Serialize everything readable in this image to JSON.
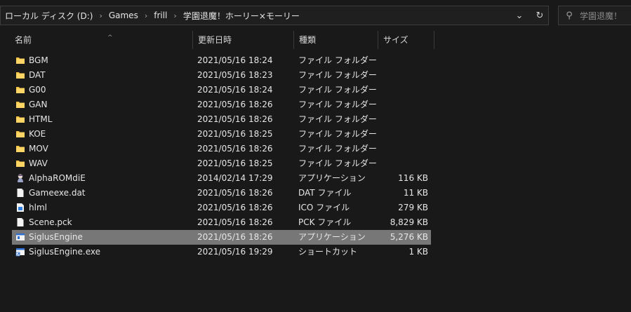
{
  "breadcrumb": {
    "items": [
      "ローカル ディスク (D:)",
      "Games",
      "frill",
      "学園退魔！ホーリー×モーリー"
    ]
  },
  "search": {
    "placeholder": "学園退魔！"
  },
  "columns": {
    "name": "名前",
    "date": "更新日時",
    "type": "種類",
    "size": "サイズ"
  },
  "files": [
    {
      "name": "BGM",
      "date": "2021/05/16 18:24",
      "type": "ファイル フォルダー",
      "size": "",
      "icon": "folder-icon"
    },
    {
      "name": "DAT",
      "date": "2021/05/16 18:23",
      "type": "ファイル フォルダー",
      "size": "",
      "icon": "folder-icon"
    },
    {
      "name": "G00",
      "date": "2021/05/16 18:24",
      "type": "ファイル フォルダー",
      "size": "",
      "icon": "folder-icon"
    },
    {
      "name": "GAN",
      "date": "2021/05/16 18:26",
      "type": "ファイル フォルダー",
      "size": "",
      "icon": "folder-icon"
    },
    {
      "name": "HTML",
      "date": "2021/05/16 18:26",
      "type": "ファイル フォルダー",
      "size": "",
      "icon": "folder-icon"
    },
    {
      "name": "KOE",
      "date": "2021/05/16 18:25",
      "type": "ファイル フォルダー",
      "size": "",
      "icon": "folder-icon"
    },
    {
      "name": "MOV",
      "date": "2021/05/16 18:26",
      "type": "ファイル フォルダー",
      "size": "",
      "icon": "folder-icon"
    },
    {
      "name": "WAV",
      "date": "2021/05/16 18:25",
      "type": "ファイル フォルダー",
      "size": "",
      "icon": "folder-icon"
    },
    {
      "name": "AlphaROMdiE",
      "date": "2014/02/14 17:29",
      "type": "アプリケーション",
      "size": "116 KB",
      "icon": "app-character-icon"
    },
    {
      "name": "Gameexe.dat",
      "date": "2021/05/16 18:26",
      "type": "DAT ファイル",
      "size": "11 KB",
      "icon": "file-icon"
    },
    {
      "name": "hlml",
      "date": "2021/05/16 18:26",
      "type": "ICO ファイル",
      "size": "279 KB",
      "icon": "ico-file-icon"
    },
    {
      "name": "Scene.pck",
      "date": "2021/05/16 18:26",
      "type": "PCK ファイル",
      "size": "8,829 KB",
      "icon": "file-icon"
    },
    {
      "name": "SiglusEngine",
      "date": "2021/05/16 18:26",
      "type": "アプリケーション",
      "size": "5,276 KB",
      "icon": "app-window-icon",
      "selected": true
    },
    {
      "name": "SiglusEngine.exe",
      "date": "2021/05/16 19:29",
      "type": "ショートカット",
      "size": "1 KB",
      "icon": "shortcut-icon"
    }
  ],
  "colors": {
    "background": "#191919",
    "selected_row": "#777777",
    "folder": "#f6c343",
    "text": "#e6e6e6"
  }
}
